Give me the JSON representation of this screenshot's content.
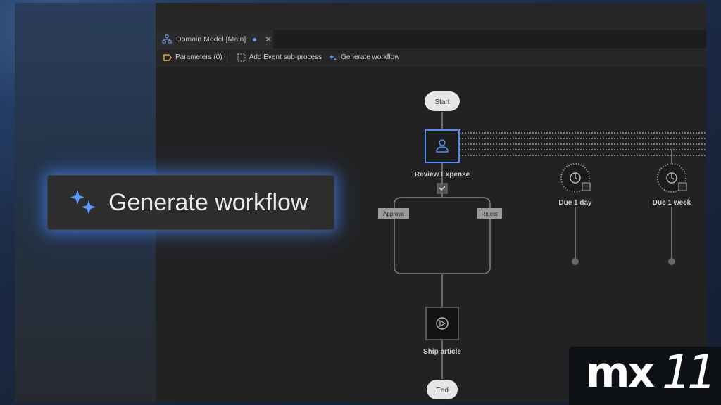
{
  "tab": {
    "title": "Domain Model [Main]"
  },
  "toolbar": {
    "parameters": "Parameters (0)",
    "add_event": "Add Event sub-process",
    "generate": "Generate workflow"
  },
  "workflow": {
    "start": "Start",
    "review": "Review Expense",
    "approve": "Approve",
    "reject": "Reject",
    "due_day": "Due 1 day",
    "due_week": "Due 1 week",
    "ship": "Ship article",
    "end": "End"
  },
  "callout": {
    "label": "Generate workflow"
  },
  "brand": {
    "mx": "mx",
    "version": "11"
  },
  "colors": {
    "accent": "#4f8ef7",
    "glow": "#5a9bff",
    "canvas": "#222222"
  },
  "icons": [
    "workflow-icon",
    "parameters-icon",
    "event-subprocess-icon",
    "sparkle-icon",
    "user-icon",
    "clock-icon",
    "play-icon"
  ]
}
